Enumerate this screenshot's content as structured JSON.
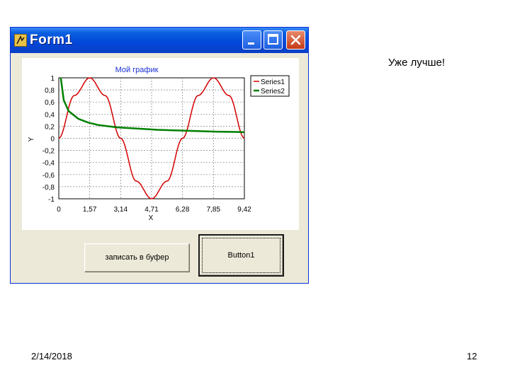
{
  "slide": {
    "note": "Уже лучше!",
    "date": "2/14/2018",
    "page_number": "12"
  },
  "window": {
    "title": "Form1",
    "icon": "delphi-app-icon",
    "controls": [
      "minimize-icon",
      "maximize-icon",
      "close-icon"
    ],
    "title_bar_color": "#0347d8",
    "close_color": "#c43b16"
  },
  "buttons": {
    "copy_label": "записать в буфер",
    "button1_label": "Button1"
  },
  "chart_data": {
    "type": "line",
    "title": "Мой график",
    "xlabel": "X",
    "ylabel": "Y",
    "xlim": [
      0,
      9.42
    ],
    "ylim": [
      -1,
      1
    ],
    "x_ticks": [
      "0",
      "1,57",
      "3,14",
      "4,71",
      "6,28",
      "7,85",
      "9,42"
    ],
    "y_ticks": [
      "1",
      "0,8",
      "0,6",
      "0,4",
      "0,2",
      "0",
      "-0,2",
      "-0,4",
      "-0,6",
      "-0,8",
      "-1"
    ],
    "grid": true,
    "legend_position": "top-right",
    "series": [
      {
        "name": "Series1",
        "color": "#d40000",
        "x": [
          0,
          0.785,
          1.571,
          2.356,
          3.142,
          3.927,
          4.712,
          5.498,
          6.283,
          7.069,
          7.854,
          8.639,
          9.425
        ],
        "values": [
          0,
          0.707,
          1,
          0.707,
          0,
          -0.707,
          -1,
          -0.707,
          0,
          0.707,
          1,
          0.707,
          0
        ]
      },
      {
        "name": "Series2",
        "color": "#008000",
        "x": [
          0.1,
          0.25,
          0.5,
          1,
          1.5,
          2,
          3,
          4,
          5,
          6,
          7,
          8,
          9,
          9.42
        ],
        "values": [
          1,
          0.63,
          0.45,
          0.32,
          0.26,
          0.22,
          0.18,
          0.16,
          0.14,
          0.13,
          0.12,
          0.11,
          0.105,
          0.1
        ]
      }
    ]
  }
}
